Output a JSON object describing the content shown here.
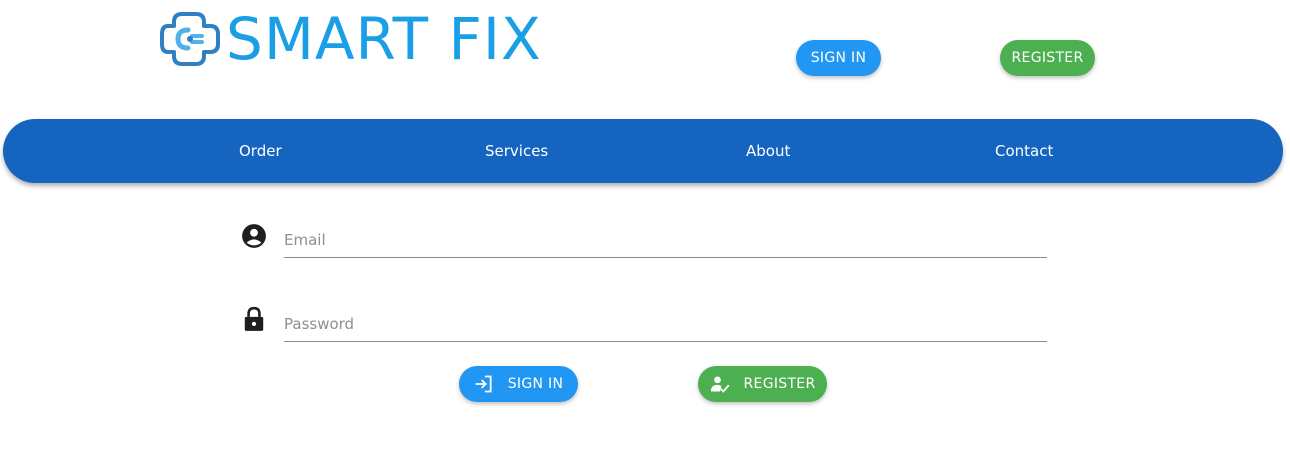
{
  "brand": {
    "name": "SMART FIX",
    "color": "#1a9ee6"
  },
  "header": {
    "signin_label": "SIGN IN",
    "register_label": "REGISTER"
  },
  "nav": {
    "items": [
      {
        "label": "Order"
      },
      {
        "label": "Services"
      },
      {
        "label": "About"
      },
      {
        "label": "Contact"
      }
    ]
  },
  "form": {
    "email": {
      "placeholder": "Email",
      "value": "",
      "icon": "account-circle-icon"
    },
    "password": {
      "placeholder": "Password",
      "value": "",
      "icon": "lock-icon"
    },
    "signin_label": "SIGN IN",
    "signin_icon": "login-icon",
    "register_label": "REGISTER",
    "register_icon": "person-check-icon"
  },
  "colors": {
    "primary_blue": "#2196f3",
    "nav_blue": "#1565c0",
    "success_green": "#4caf50"
  }
}
